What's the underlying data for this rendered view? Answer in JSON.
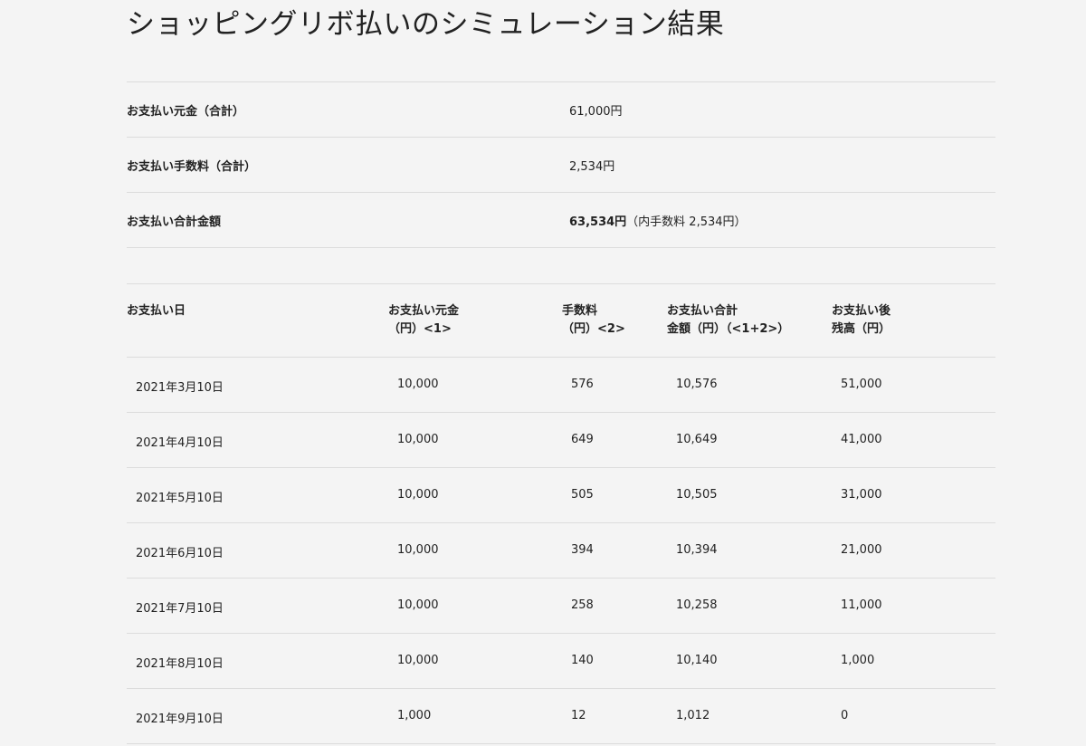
{
  "page": {
    "title": "ショッピングリボ払いのシミュレーション結果"
  },
  "summary": {
    "rows": [
      {
        "label": "お支払い元金（合計）",
        "value": "61,000円",
        "note": ""
      },
      {
        "label": "お支払い手数料（合計）",
        "value": "2,534円",
        "note": ""
      },
      {
        "label": "お支払い合計金額",
        "value": "63,534円",
        "note": "（内手数料 2,534円）"
      }
    ]
  },
  "schedule": {
    "headers": [
      {
        "line1": "お支払い日",
        "line2": ""
      },
      {
        "line1": "お支払い元金",
        "line2": "（円）<1>"
      },
      {
        "line1": "手数料",
        "line2": "（円）<2>"
      },
      {
        "line1": "お支払い合計",
        "line2": "金額（円）（<1+2>）"
      },
      {
        "line1": "お支払い後",
        "line2": "残高（円）"
      }
    ],
    "rows": [
      [
        "2021年3月10日",
        "10,000",
        "576",
        "10,576",
        "51,000"
      ],
      [
        "2021年4月10日",
        "10,000",
        "649",
        "10,649",
        "41,000"
      ],
      [
        "2021年5月10日",
        "10,000",
        "505",
        "10,505",
        "31,000"
      ],
      [
        "2021年6月10日",
        "10,000",
        "394",
        "10,394",
        "21,000"
      ],
      [
        "2021年7月10日",
        "10,000",
        "258",
        "10,258",
        "11,000"
      ],
      [
        "2021年8月10日",
        "10,000",
        "140",
        "10,140",
        "1,000"
      ],
      [
        "2021年9月10日",
        "1,000",
        "12",
        "1,012",
        "0"
      ]
    ]
  }
}
